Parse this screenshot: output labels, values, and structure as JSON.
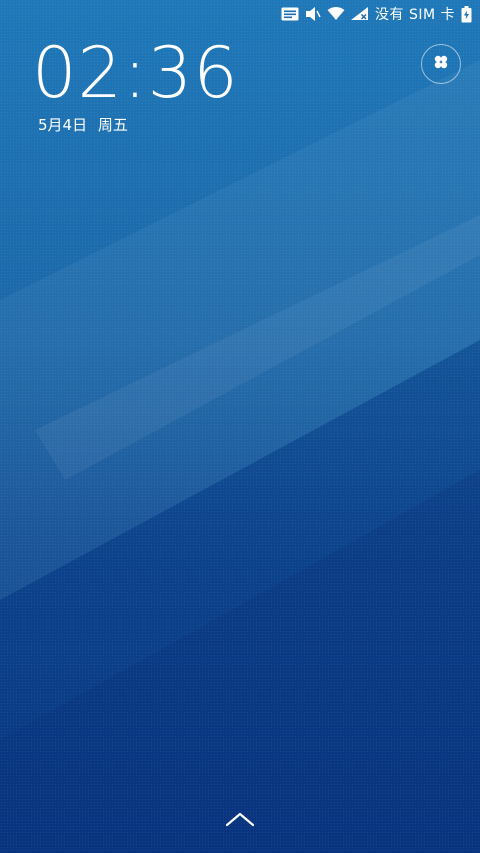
{
  "status_bar": {
    "carrier_text": "没有 SIM 卡",
    "icons": [
      "notification-message-icon",
      "volume-mute-icon",
      "wifi-icon",
      "no-signal-icon",
      "battery-charging-icon"
    ]
  },
  "lockscreen": {
    "time": "02:36",
    "date": "5月4日",
    "weekday": "周五",
    "quick_button_icon": "four-petal-flower-icon",
    "unlock_icon": "chevron-up-icon"
  },
  "colors": {
    "background_top": "#1f76b7",
    "background_bottom": "#0a3a86",
    "text": "#ffffff"
  }
}
